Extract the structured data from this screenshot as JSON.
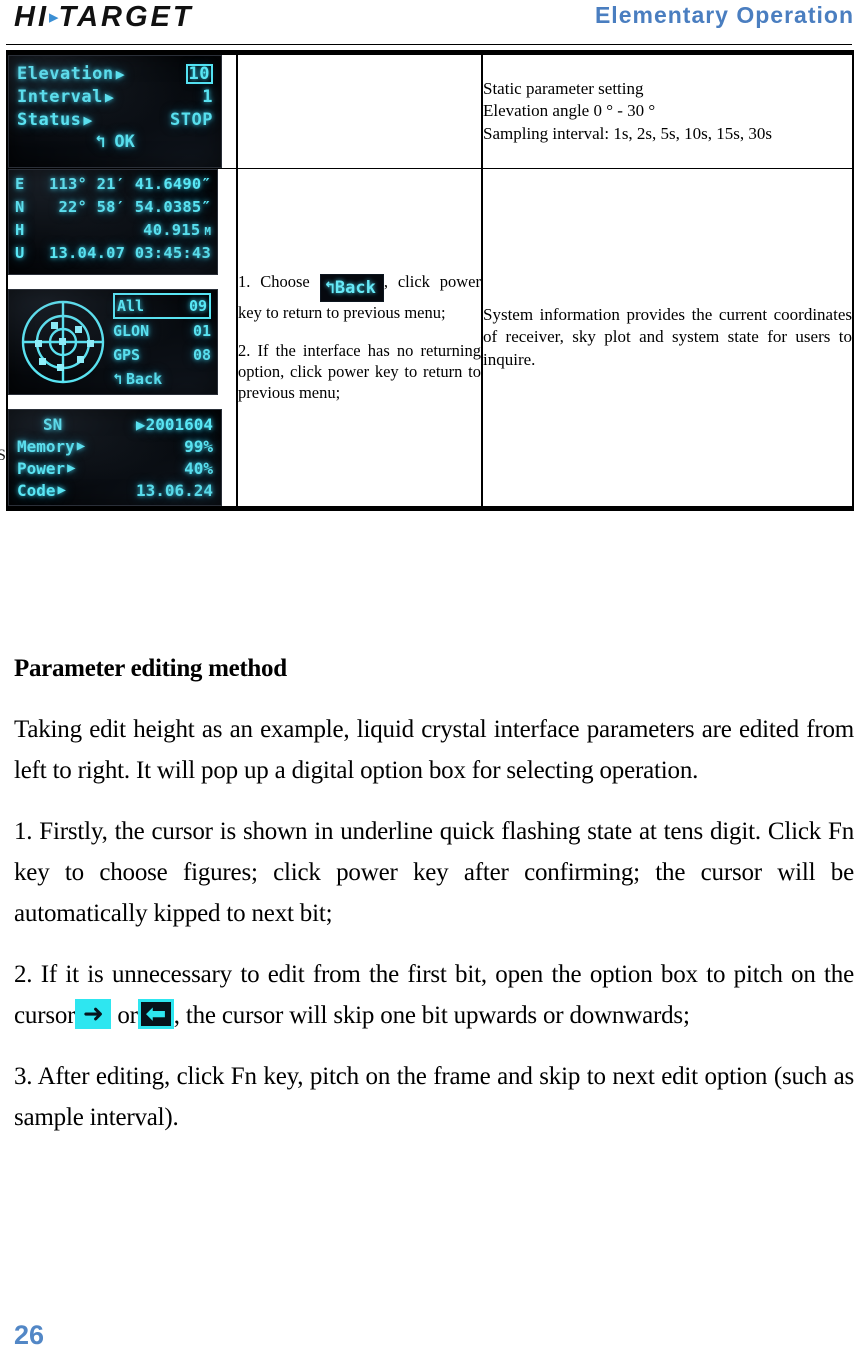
{
  "header": {
    "logo_main": "HI",
    "logo_sep": "▸",
    "logo_rest": "TARGET",
    "title": "Elementary  Operation"
  },
  "table": {
    "rows": [
      {
        "screens": [
          {
            "name": "static-parameter-screen",
            "lines": [
              {
                "label": "Elevation",
                "arrow": "▶",
                "value": "10",
                "boxed": true
              },
              {
                "label": "Interval",
                "arrow": "▶",
                "value": "1",
                "boxed": false
              },
              {
                "label": "Status",
                "arrow": "▶",
                "value": "STOP",
                "boxed": false
              }
            ],
            "footer_icon": "↰",
            "footer_label": "OK"
          }
        ],
        "middle": "",
        "right": [
          "Static parameter setting",
          "Elevation angle 0 ° - 30 °",
          "Sampling interval: 1s, 2s, 5s, 10s, 15s, 30s"
        ]
      },
      {
        "screens": [
          {
            "name": "coordinates-screen",
            "rows": [
              {
                "prefix": "E",
                "body": "113° 21′ 41.6490″",
                "unit": ""
              },
              {
                "prefix": "N",
                "body": "22° 58′ 54.0385″",
                "unit": ""
              },
              {
                "prefix": "H",
                "body": "40.915",
                "unit": "M"
              },
              {
                "prefix": "U",
                "body": "13.04.07 03:45:43",
                "unit": ""
              }
            ]
          },
          {
            "name": "sky-plot-screen",
            "items": [
              {
                "key": "All",
                "value": "09",
                "boxed": true
              },
              {
                "key": "GLON",
                "value": "01",
                "boxed": false
              },
              {
                "key": "GPS",
                "value": "08",
                "boxed": false
              }
            ],
            "back_icon": "↰",
            "back_label": "Back"
          },
          {
            "name": "system-info-screen",
            "ghost_char": "S",
            "items": [
              {
                "key": "SN",
                "arrow": "▶",
                "value": "2001604"
              },
              {
                "key": "Memory",
                "arrow": "▶",
                "value": "99%"
              },
              {
                "key": "Power",
                "arrow": "▶",
                "value": "40%"
              },
              {
                "key": "Code",
                "arrow": "▶",
                "value": "13.06.24"
              }
            ]
          }
        ],
        "middle_item1_pre": "1. Choose",
        "middle_badge_icon": "↰",
        "middle_badge_label": "Back",
        "middle_item1_post": ", click power key to return to previous menu;",
        "middle_item2": "2. If the interface has no returning option, click power key to return to previous menu;",
        "right": [
          "System information provides the current coordinates of receiver, sky plot and system state for users to inquire."
        ]
      }
    ]
  },
  "body": {
    "section_title": "Parameter editing method",
    "intro": "Taking edit height as an example, liquid crystal interface parameters are edited from left to right. It will pop up a digital option box for selecting operation.",
    "step1": "1. Firstly, the cursor is shown in underline quick flashing state at tens digit. Click Fn key to choose figures; click power key after confirming; the cursor will be automatically kipped to next bit;",
    "step2_pre": "2. If it is unnecessary to edit from the first bit, open the option box to pitch on the cursor",
    "step2_icon_right": "➜",
    "step2_mid": "or",
    "step2_icon_left": "⬅",
    "step2_post": ", the cursor will skip one bit upwards or downwards;",
    "step3": "3. After editing, click Fn key, pitch on the frame and skip to next edit option (such as sample interval)."
  },
  "footer": {
    "page_number": "26"
  }
}
